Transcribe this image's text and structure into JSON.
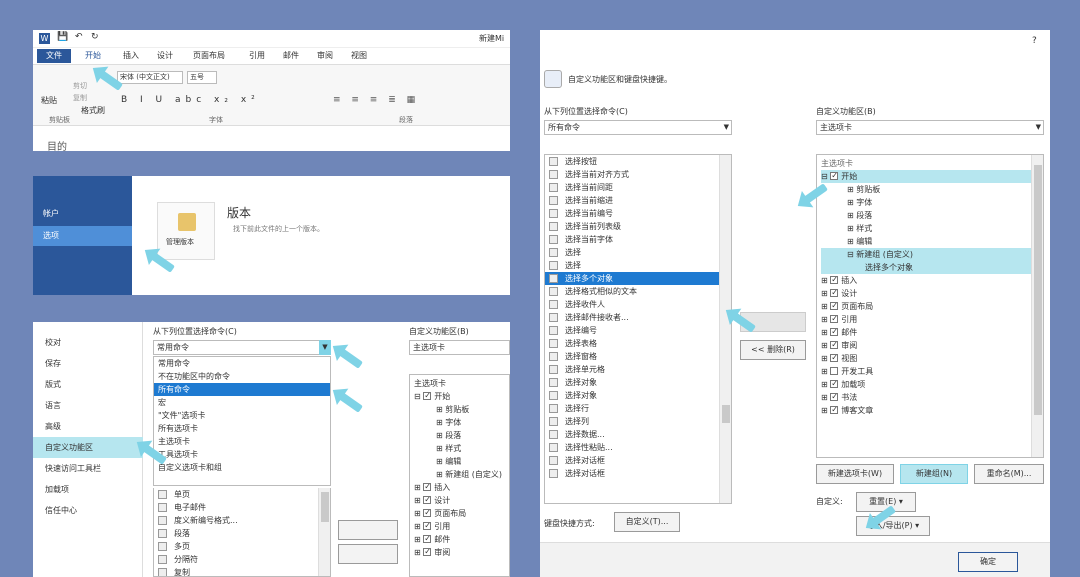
{
  "ribbon": {
    "title": "新建Mi",
    "tabs": [
      "文件",
      "开始",
      "插入",
      "设计",
      "页面布局",
      "引用",
      "邮件",
      "审阅",
      "视图"
    ],
    "font_name": "宋体 (中文正文)",
    "font_size": "五号",
    "paste_label": "粘贴",
    "clip_items": [
      "剪切",
      "复制",
      "格式刷"
    ],
    "groups": [
      "剪贴板",
      "字体",
      "段落"
    ],
    "doc_text": "目的"
  },
  "info_panel": {
    "nav_items": [
      "帐户",
      "选项"
    ],
    "version_title": "版本",
    "version_desc": "找下前此文件的上一个版本。",
    "manage_label": "管理版本"
  },
  "options_panel": {
    "nav_items": [
      "校对",
      "保存",
      "版式",
      "语言",
      "高级",
      "自定义功能区",
      "快速访问工具栏",
      "加载项",
      "信任中心"
    ],
    "choose_label": "从下列位置选择命令(C)",
    "dropdown_value": "常用命令",
    "dropdown_options": [
      "常用命令",
      "不在功能区中的命令",
      "所有命令",
      "宏",
      "\"文件\"选项卡",
      "所有选项卡",
      "主选项卡",
      "工具选项卡",
      "自定义选项卡和组"
    ],
    "list_items": [
      "单页",
      "电子邮件",
      "度义新编号格式...",
      "段落",
      "多页",
      "分隔符",
      "复制"
    ],
    "custom_label": "自定义功能区(B)",
    "custom_value": "主选项卡",
    "tree_header": "主选项卡",
    "tree_items": [
      "开始",
      "剪贴板",
      "字体",
      "段落",
      "样式",
      "编辑",
      "新建组 (自定义)",
      "插入",
      "设计",
      "页面布局",
      "引用",
      "邮件",
      "审阅"
    ]
  },
  "dialog": {
    "close_glyph": "?",
    "header_text": "自定义功能区和键盘快捷键。",
    "choose_label": "从下列位置选择命令(C)",
    "choose_value": "所有命令",
    "custom_label": "自定义功能区(B)",
    "custom_value": "主选项卡",
    "commands": [
      "选择按钮",
      "选择当前对齐方式",
      "选择当前间距",
      "选择当前缩进",
      "选择当前编号",
      "选择当前列表级",
      "选择当前字体",
      "选择",
      "选择",
      "选择多个对象",
      "选择格式相似的文本",
      "选择收件人",
      "选择邮件接收者...",
      "选择编号",
      "选择表格",
      "选择窗格",
      "选择单元格",
      "选择对象",
      "选择对象",
      "选择行",
      "选择列",
      "选择数据...",
      "选择性粘贴...",
      "选择对话框",
      "选择对话框"
    ],
    "remove_label": "<< 删除(R)",
    "tree_header": "主选项卡",
    "tree_items": [
      "开始",
      "剪贴板",
      "字体",
      "段落",
      "样式",
      "编辑",
      "新建组 (自定义)",
      "选择多个对象",
      "插入",
      "设计",
      "页面布局",
      "引用",
      "邮件",
      "审阅",
      "视图",
      "开发工具",
      "加载项",
      "书法",
      "博客文章"
    ],
    "btn_new_tab": "新建选项卡(W)",
    "btn_new_group": "新建组(N)",
    "btn_rename": "重命名(M)...",
    "custom_field_label": "自定义:",
    "reset_label": "重置(E)",
    "import_export": "导入/导出(P)",
    "shortcut_label": "键盘快捷方式:",
    "shortcut_button": "自定义(T)...",
    "ok": "确定"
  },
  "colors": {
    "accent": "#2b579a",
    "highlight": "#1e7ad1",
    "cyan": "#7fd3e6",
    "bg": "#6f86b8"
  }
}
